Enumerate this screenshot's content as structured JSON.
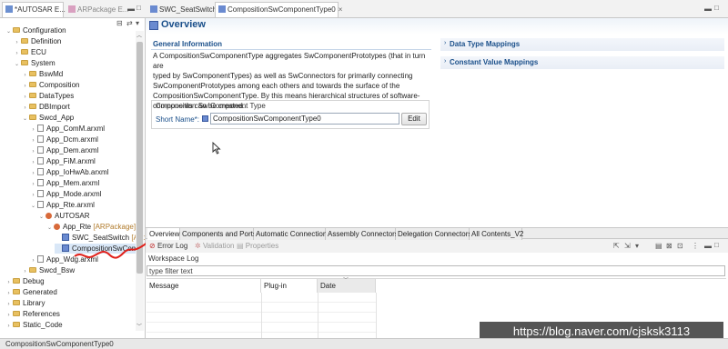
{
  "left_tabs": [
    {
      "label": "*AUTOSAR E...",
      "active": true
    },
    {
      "label": "ARPackage E...",
      "active": false
    }
  ],
  "tree": [
    {
      "label": "Configuration",
      "type": "folder",
      "expanded": true
    },
    {
      "label": "Definition",
      "type": "folder",
      "expanded": false
    },
    {
      "label": "ECU",
      "type": "folder",
      "expanded": false
    },
    {
      "label": "System",
      "type": "folder",
      "expanded": true
    },
    {
      "label": "BswMd",
      "type": "folder",
      "expanded": false
    },
    {
      "label": "Composition",
      "type": "folder",
      "expanded": false
    },
    {
      "label": "DataTypes",
      "type": "folder",
      "expanded": false
    },
    {
      "label": "DBImport",
      "type": "folder",
      "expanded": false
    },
    {
      "label": "Swcd_App",
      "type": "folder",
      "expanded": true
    },
    {
      "label": "App_ComM.arxml",
      "type": "file",
      "expanded": false
    },
    {
      "label": "App_Dcm.arxml",
      "type": "file",
      "expanded": false
    },
    {
      "label": "App_Dem.arxml",
      "type": "file",
      "expanded": false
    },
    {
      "label": "App_FiM.arxml",
      "type": "file",
      "expanded": false
    },
    {
      "label": "App_IoHwAb.arxml",
      "type": "file",
      "expanded": false
    },
    {
      "label": "App_Mem.arxml",
      "type": "file",
      "expanded": false
    },
    {
      "label": "App_Mode.arxml",
      "type": "file",
      "expanded": false
    },
    {
      "label": "App_Rte.arxml",
      "type": "file",
      "expanded": true
    },
    {
      "label": "AUTOSAR",
      "type": "package",
      "expanded": true
    },
    {
      "label": "App_Rte",
      "hint": "[ARPackage]",
      "type": "package",
      "expanded": true
    },
    {
      "label": "SWC_SeatSwitch",
      "hint": "[App",
      "type": "swc",
      "expanded": false
    },
    {
      "label": "CompositionSwComp",
      "hint": "",
      "type": "swc",
      "expanded": false,
      "selected": true
    },
    {
      "label": "App_Wdg.arxml",
      "type": "file",
      "expanded": false
    },
    {
      "label": "Swcd_Bsw",
      "type": "folder",
      "expanded": false
    },
    {
      "label": "Debug",
      "type": "folder",
      "expanded": false
    },
    {
      "label": "Generated",
      "type": "folder",
      "expanded": false
    },
    {
      "label": "Library",
      "type": "folder",
      "expanded": false
    },
    {
      "label": "References",
      "type": "folder",
      "expanded": false
    },
    {
      "label": "Static_Code",
      "type": "folder",
      "expanded": false
    }
  ],
  "editor_tabs": [
    {
      "label": "SWC_SeatSwitch",
      "active": false
    },
    {
      "label": "CompositionSwComponentType0",
      "active": true
    }
  ],
  "overview": {
    "title": "Overview",
    "general_info_title": "General Information",
    "description_lines": [
      "A CompositionSwComponentType aggregates SwComponentPrototypes (that in turn are",
      "typed by SwComponentTypes) as well as SwConnectors for primarily connecting",
      "SwComponentPrototypes among each others and towards the surface of the",
      "CompositionSwComponentType. By this means hierarchical structures of software-",
      "components can be created."
    ],
    "group_title": "Composition Sw Component Type",
    "short_name_label": "Short Name*:",
    "short_name_value": "CompositionSwComponentType0",
    "edit_button": "Edit",
    "right_sections": [
      "Data Type Mappings",
      "Constant Value Mappings"
    ]
  },
  "bottom_tabs": [
    {
      "label": "Overview",
      "active": true
    },
    {
      "label": "Components and Ports",
      "active": false
    },
    {
      "label": "Automatic Connection",
      "active": false
    },
    {
      "label": "Assembly Connectors",
      "active": false
    },
    {
      "label": "Delegation Connectors",
      "active": false
    },
    {
      "label": "All Contents_V2",
      "active": false
    }
  ],
  "log_tabs": [
    {
      "label": "Error Log",
      "dim": false
    },
    {
      "label": "Validation",
      "dim": true
    },
    {
      "label": "Properties",
      "dim": true
    }
  ],
  "log": {
    "workspace_label": "Workspace Log",
    "filter_placeholder": "type filter text",
    "columns": [
      "Message",
      "Plug-in",
      "Date"
    ]
  },
  "watermark": "https://blog.naver.com/cjsksk3113",
  "status_text": "CompositionSwComponentType0",
  "colors": {
    "accent": "#1a4f8a",
    "selection": "#d9e7f7",
    "annotation_red": "#e0201a"
  }
}
